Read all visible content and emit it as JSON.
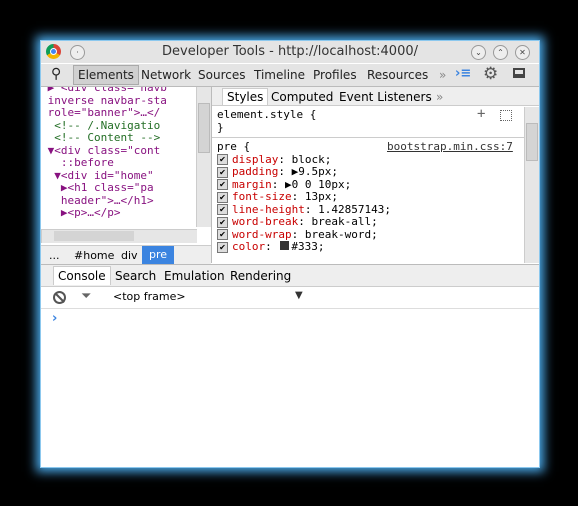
{
  "window": {
    "title": "Developer Tools - http://localhost:4000/"
  },
  "toolbar": {
    "tabs": [
      "Elements",
      "Network",
      "Sources",
      "Timeline",
      "Profiles",
      "Resources"
    ],
    "more": "»"
  },
  "dom": {
    "lines": [
      {
        "indent": 2,
        "html": "▶ <div class=\"navb"
      },
      {
        "indent": 2,
        "text": "inverse navbar-sta"
      },
      {
        "indent": 2,
        "text": "role=\"banner\">…</"
      },
      {
        "indent": 3,
        "comment": "<!-- /.Navigatio"
      },
      {
        "indent": 3,
        "comment": "<!-- Content -->"
      },
      {
        "indent": 2,
        "text": "▼<div class=\"cont"
      },
      {
        "indent": 4,
        "text": "::before"
      },
      {
        "indent": 3,
        "text": "▼<div id=\"home\""
      },
      {
        "indent": 4,
        "text": "▶<h1 class=\"pa"
      },
      {
        "indent": 4,
        "text": "header\">…</h1>"
      },
      {
        "indent": 4,
        "text": "▶<p>…</p>"
      }
    ]
  },
  "breadcrumb": [
    "...",
    "#home",
    "div",
    "pre"
  ],
  "styles": {
    "tabs": [
      "Styles",
      "Computed",
      "Event Listeners",
      "»"
    ],
    "element_style": "element.style {",
    "close": "}",
    "selector": "pre {",
    "source": "bootstrap.min.css:7",
    "props": [
      [
        "display",
        "block"
      ],
      [
        "padding",
        "▶9.5px"
      ],
      [
        "margin",
        "▶0 0 10px"
      ],
      [
        "font-size",
        "13px"
      ],
      [
        "line-height",
        "1.42857143"
      ],
      [
        "word-break",
        "break-all"
      ],
      [
        "word-wrap",
        "break-word"
      ],
      [
        "color",
        "#333"
      ]
    ]
  },
  "drawer": {
    "tabs": [
      "Console",
      "Search",
      "Emulation",
      "Rendering"
    ],
    "frame": "<top frame>",
    "prompt": "›"
  }
}
